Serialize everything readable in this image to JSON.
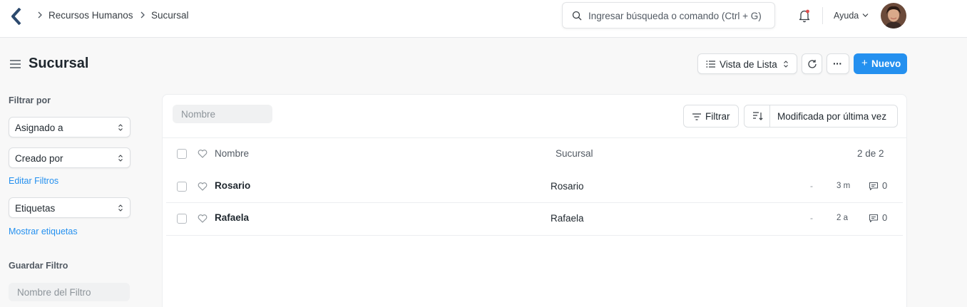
{
  "breadcrumb": [
    "Recursos Humanos",
    "Sucursal"
  ],
  "search": {
    "placeholder": "Ingresar búsqueda o comando (Ctrl + G)"
  },
  "help_label": "Ayuda",
  "page": {
    "title": "Sucursal"
  },
  "toolbar": {
    "view_label": "Vista de Lista",
    "more_label": "···",
    "new_label": "Nuevo"
  },
  "sidebar": {
    "filter_heading": "Filtrar por",
    "assigned_to": "Asignado a",
    "created_by": "Creado por",
    "edit_filters": "Editar Filtros",
    "tags": "Etiquetas",
    "show_tags": "Mostrar etiquetas",
    "save_filter_heading": "Guardar Filtro",
    "filter_name_placeholder": "Nombre del Filtro"
  },
  "list": {
    "name_filter_placeholder": "Nombre",
    "filter_button": "Filtrar",
    "sort_label": "Modificada por última vez",
    "header": {
      "name": "Nombre",
      "branch": "Sucursal",
      "count": "2 de 2"
    },
    "rows": [
      {
        "name": "Rosario",
        "branch": "Rosario",
        "dash": "-",
        "modified": "3 m",
        "comments": "0"
      },
      {
        "name": "Rafaela",
        "branch": "Rafaela",
        "dash": "-",
        "modified": "2 a",
        "comments": "0"
      }
    ]
  },
  "colors": {
    "accent": "#2490ef",
    "text": "#1f272e",
    "muted": "#525a63",
    "background": "#f8f8f8"
  }
}
